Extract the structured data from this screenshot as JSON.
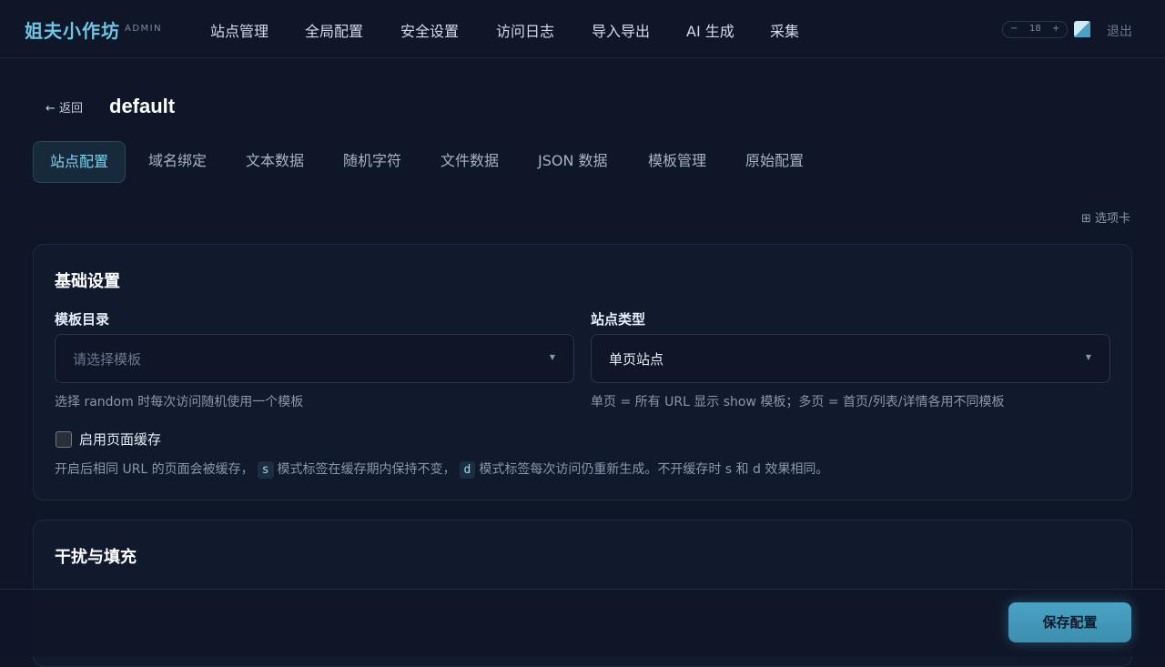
{
  "header": {
    "brand": "姐夫小作坊",
    "brand_sub": "ADMIN",
    "nav": [
      "站点管理",
      "全局配置",
      "安全设置",
      "访问日志",
      "导入导出",
      "AI 生成",
      "采集"
    ],
    "zoom": {
      "minus": "−",
      "value": "18",
      "plus": "+"
    },
    "theme_icon": "theme-toggle-icon",
    "logout": "退出"
  },
  "page": {
    "back": "← 返回",
    "title": "default"
  },
  "tabs": [
    "站点配置",
    "域名绑定",
    "文本数据",
    "随机字符",
    "文件数据",
    "JSON 数据",
    "模板管理",
    "原始配置"
  ],
  "tab_toggle": "⊞ 选项卡",
  "basic": {
    "title": "基础设置",
    "template_label": "模板目录",
    "template_placeholder": "请选择模板",
    "template_hint": "选择 random 时每次访问随机使用一个模板",
    "sitetype_label": "站点类型",
    "sitetype_value": "单页站点",
    "sitetype_hint": "单页 = 所有 URL 显示 show 模板；多页 = 首页/列表/详情各用不同模板",
    "cache_label": "启用页面缓存",
    "cache_hint_1": "开启后相同 URL 的页面会被缓存，",
    "cache_code_s": "s",
    "cache_hint_2": "模式标签在缓存期内保持不变，",
    "cache_code_d": "d",
    "cache_hint_3": "模式标签每次访问仍重新生成。不开缓存时 s 和 d 效果相同。"
  },
  "interference": {
    "title": "干扰与填充"
  },
  "footer": {
    "save": "保存配置"
  }
}
